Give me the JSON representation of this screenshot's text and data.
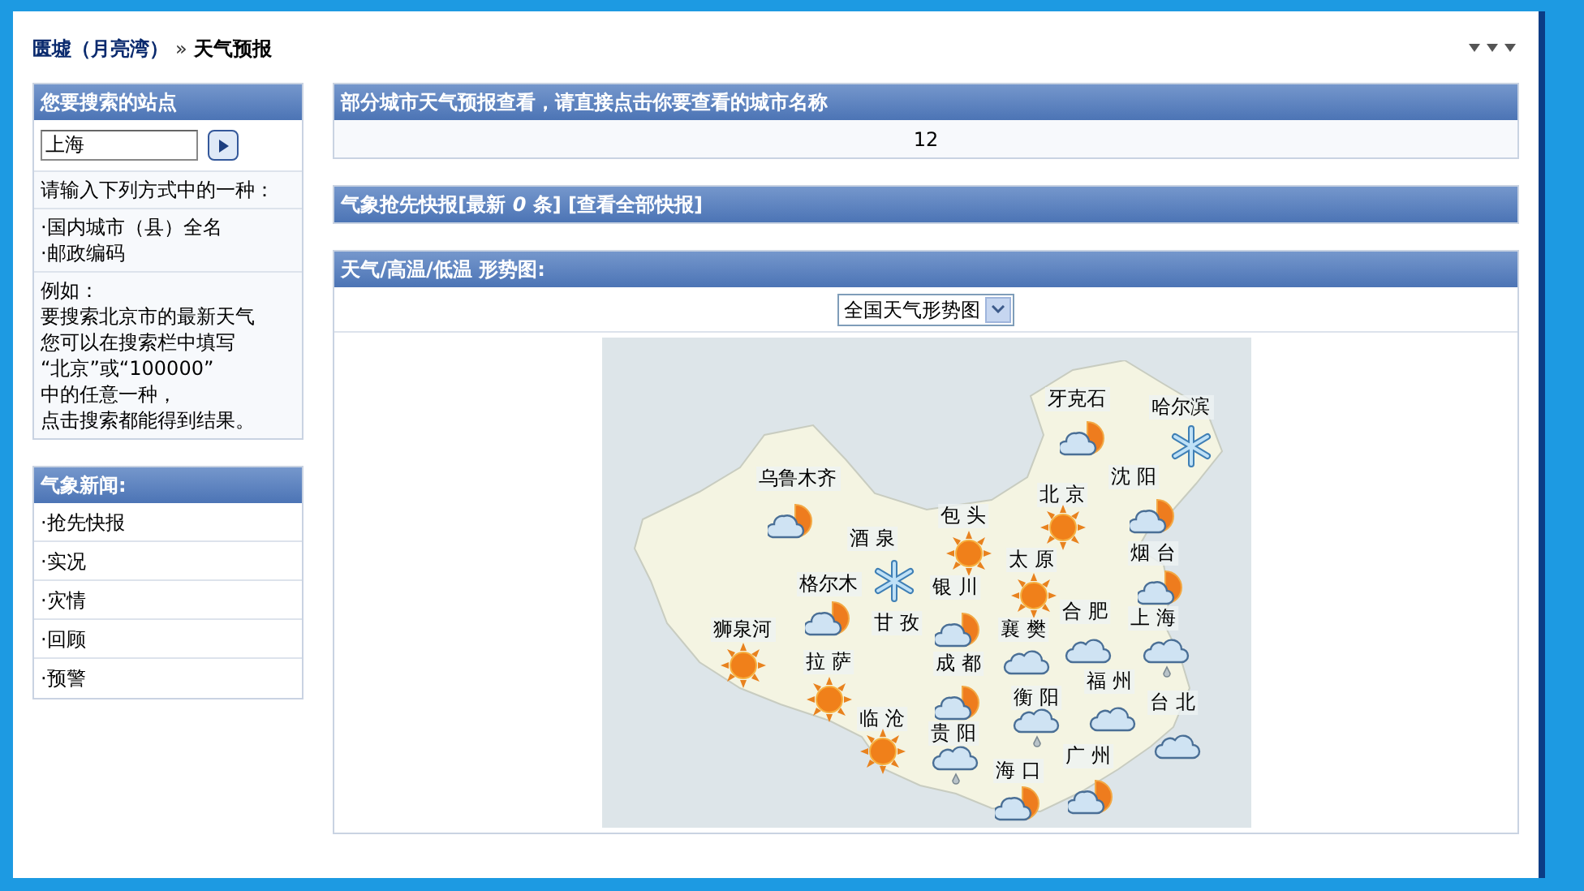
{
  "breadcrumb": {
    "forum": "匮墟（月亮湾）",
    "separator": "»",
    "current": "天气预报"
  },
  "sidebar": {
    "search_panel": {
      "title": "您要搜索的站点",
      "search": {
        "value": "上海"
      },
      "hint": "请输入下列方式中的一种：",
      "options": [
        "·国内城市（县）全名",
        "·邮政编码"
      ],
      "example": [
        "例如：",
        "要搜索北京市的最新天气",
        "您可以在搜索栏中填写",
        "“北京”或“100000”",
        "中的任意一种，",
        "点击搜索都能得到结果。"
      ]
    },
    "news_panel": {
      "title": "气象新闻:",
      "items": [
        "·抢先快报",
        "·实况",
        "·灾情",
        "·回顾",
        "·预警"
      ]
    }
  },
  "city_forecast": {
    "title": "部分城市天气预报查看，请直接点击你要查看的城市名称",
    "content": "12"
  },
  "flash_news": {
    "title": "气象抢先快报[最新 *0* 条] [查看全部快报]"
  },
  "weather_map": {
    "title": "天气/高温/低温 形势图:",
    "select": {
      "value": "全国天气形势图"
    },
    "cities": [
      {
        "label": "牙克石",
        "kind": "partly"
      },
      {
        "label": "哈尔滨",
        "kind": "snow"
      },
      {
        "label": "乌鲁木齐",
        "kind": "partly"
      },
      {
        "label": "沈 阳",
        "kind": "partly"
      },
      {
        "label": "北 京",
        "kind": "sun"
      },
      {
        "label": "包 头",
        "kind": "sun"
      },
      {
        "label": "酒 泉",
        "kind": "snow"
      },
      {
        "label": "太 原",
        "kind": "sun"
      },
      {
        "label": "烟 台",
        "kind": "partly"
      },
      {
        "label": "格尔木",
        "kind": "partly"
      },
      {
        "label": "银 川",
        "kind": "partly"
      },
      {
        "label": "合 肥",
        "kind": "cloud"
      },
      {
        "label": "上 海",
        "kind": "rain"
      },
      {
        "label": "狮泉河",
        "kind": "sun"
      },
      {
        "label": "甘 孜",
        "kind": "none"
      },
      {
        "label": "襄 樊",
        "kind": "cloud"
      },
      {
        "label": "拉 萨",
        "kind": "sun"
      },
      {
        "label": "成 都",
        "kind": "partly"
      },
      {
        "label": "福 州",
        "kind": "cloud"
      },
      {
        "label": "衡 阳",
        "kind": "rain"
      },
      {
        "label": "台 北",
        "kind": "cloud"
      },
      {
        "label": "临 沧",
        "kind": "sun"
      },
      {
        "label": "贵 阳",
        "kind": "rain"
      },
      {
        "label": "广 州",
        "kind": "partly"
      },
      {
        "label": "海 口",
        "kind": "partly"
      }
    ]
  }
}
